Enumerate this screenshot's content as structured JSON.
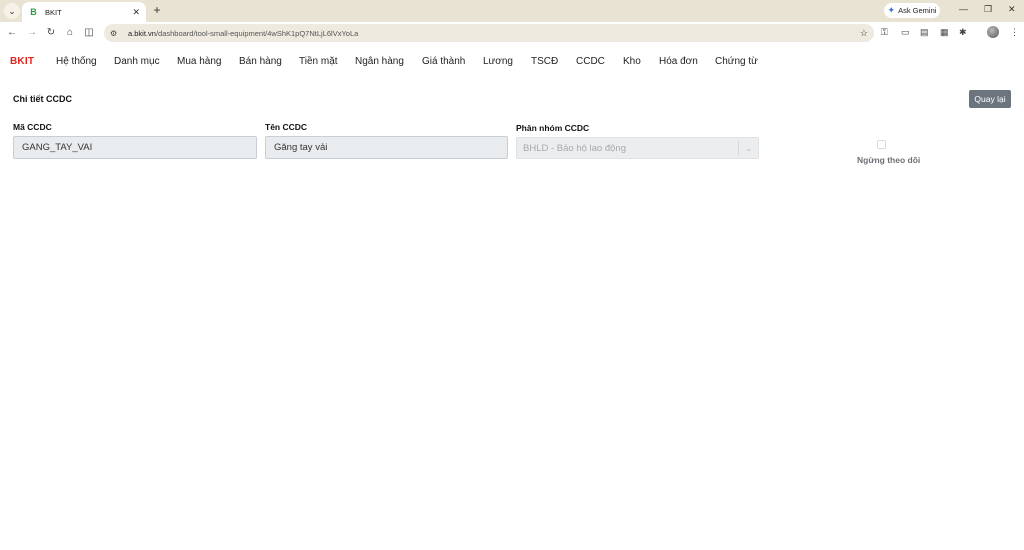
{
  "browser": {
    "tab_title": "BKIT",
    "tab_favicon": "B",
    "url_host": "a.bkit.vn",
    "url_path": "/dashboard/tool-small-equipment/4wShK1pQ7NtLjL6lVxYoLa",
    "ask_gemini": "Ask Gemini"
  },
  "app": {
    "logo": "BKIT",
    "menu": [
      "Hệ thống",
      "Danh mục",
      "Mua hàng",
      "Bán hàng",
      "Tiền mặt",
      "Ngân hàng",
      "Giá thành",
      "Lương",
      "TSCĐ",
      "CCDC",
      "Kho",
      "Hóa đơn",
      "Chứng từ"
    ]
  },
  "page": {
    "title": "Chi tiết CCDC",
    "back_label": "Quay lại",
    "fields": {
      "code_label": "Mã CCDC",
      "code_value": "GANG_TAY_VAI",
      "name_label": "Tên CCDC",
      "name_value": "Găng tay vải",
      "group_label": "Phân nhóm CCDC",
      "group_value": "BHLD - Bảo hộ lao động"
    },
    "stop_tracking_label": "Ngừng theo dõi"
  }
}
